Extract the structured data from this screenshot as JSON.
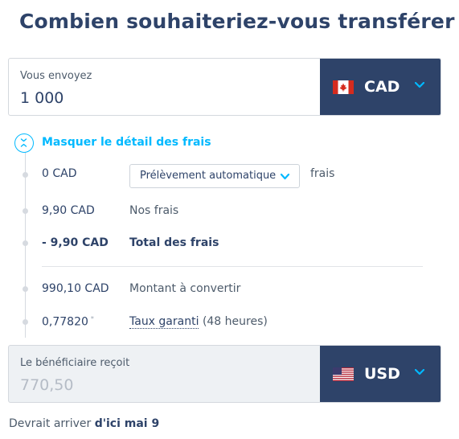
{
  "title": "Combien souhaiteriez-vous transférer ?",
  "send": {
    "label": "Vous envoyez",
    "amount": "1 000",
    "currency": "CAD",
    "flag_icon": "flag-canada-icon"
  },
  "fees": {
    "toggle_label": "Masquer le détail des frais",
    "payment_fee_amount": "0 CAD",
    "payment_method_selected": "Prélèvement automatique",
    "payment_fee_suffix": "frais",
    "our_fee_amount": "9,90 CAD",
    "our_fee_label": "Nos frais",
    "total_amount": "- 9,90 CAD",
    "total_label": "Total des frais",
    "convert_amount": "990,10 CAD",
    "convert_label": "Montant à convertir",
    "rate_value": "0,77820",
    "rate_marker": "*",
    "rate_label": "Taux garanti",
    "rate_duration": "(48 heures)"
  },
  "receive": {
    "label": "Le bénéficiaire reçoit",
    "amount": "770,50",
    "currency": "USD",
    "flag_icon": "flag-usa-icon"
  },
  "footer": {
    "prefix": "Devrait arriver",
    "date": "d'ici mai 9"
  },
  "colors": {
    "navy": "#2e4369",
    "accent": "#00b9ff",
    "timeline": "#d6dae0"
  }
}
